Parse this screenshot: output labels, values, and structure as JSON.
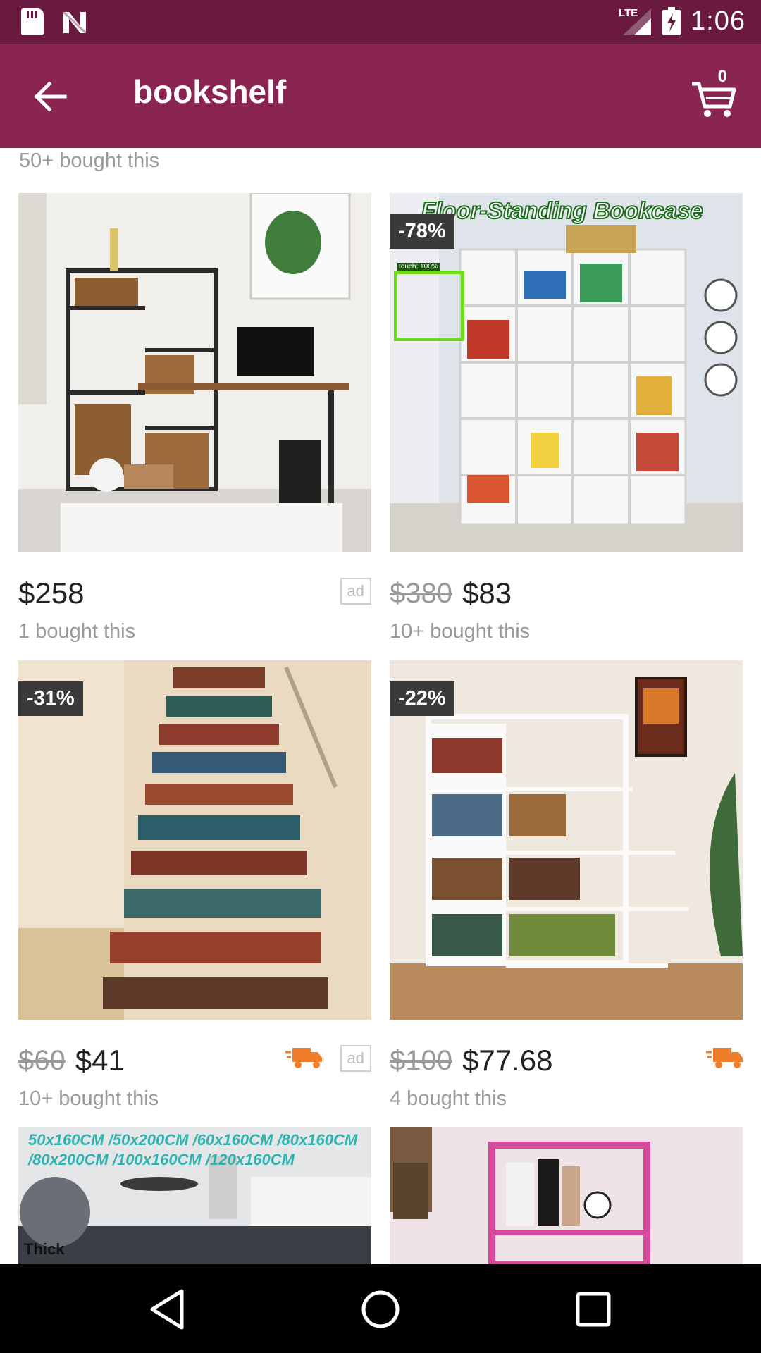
{
  "status_bar": {
    "time": "1:06",
    "network": "LTE"
  },
  "app_bar": {
    "title": "bookshelf",
    "cart_count": "0"
  },
  "top_row_bought": "50+ bought this",
  "products": [
    {
      "discount": "",
      "old_price": "",
      "price": "$258",
      "bought": "1 bought this",
      "ad": "ad",
      "truck": false,
      "banner_text": ""
    },
    {
      "discount": "-78%",
      "old_price": "$380",
      "price": "$83",
      "bought": "10+ bought this",
      "ad": "",
      "truck": false,
      "banner_text": "Floor-Standing Bookcase",
      "overlay_label": "touch: 100%"
    },
    {
      "discount": "-31%",
      "old_price": "$60",
      "price": "$41",
      "bought": "10+ bought this",
      "ad": "ad",
      "truck": true,
      "banner_text": ""
    },
    {
      "discount": "-22%",
      "old_price": "$100",
      "price": "$77.68",
      "bought": "4 bought this",
      "ad": "",
      "truck": true,
      "banner_text": ""
    },
    {
      "banner_text": "50x160CM /50x200CM /60x160CM /80x160CM /80x200CM /100x160CM /120x160CM",
      "thick_label": "Thick"
    },
    {
      "banner_text": ""
    }
  ],
  "colors": {
    "status_bar": "#6a1a3e",
    "app_bar": "#8a2450",
    "truck": "#f07d2a"
  }
}
